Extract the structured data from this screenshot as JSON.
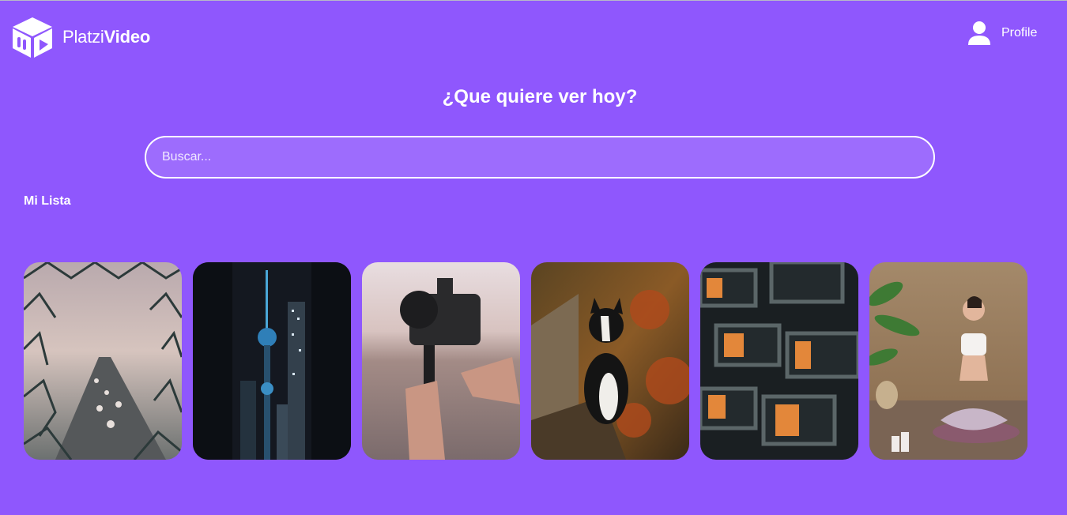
{
  "header": {
    "logo": {
      "text_light": "Platzi",
      "text_bold": "Video",
      "icon": "cube-play-logo-icon"
    },
    "profile": {
      "label": "Profile",
      "icon": "user-icon"
    }
  },
  "main": {
    "title": "¿Que quiere ver hoy?",
    "search": {
      "placeholder": "Buscar...",
      "value": ""
    }
  },
  "my_list": {
    "title": "Mi Lista",
    "items": [
      {
        "subject": "highway through torn chain-link fence"
      },
      {
        "subject": "city tower skyline at night"
      },
      {
        "subject": "camera on monopod by the sea"
      },
      {
        "subject": "black and white dog on wooden bench"
      },
      {
        "subject": "modern building with lit windows"
      },
      {
        "subject": "woman meditating in yoga pose"
      }
    ]
  },
  "colors": {
    "background": "#8f57fd",
    "search_bg": "#9d6cfd",
    "text": "#ffffff"
  }
}
